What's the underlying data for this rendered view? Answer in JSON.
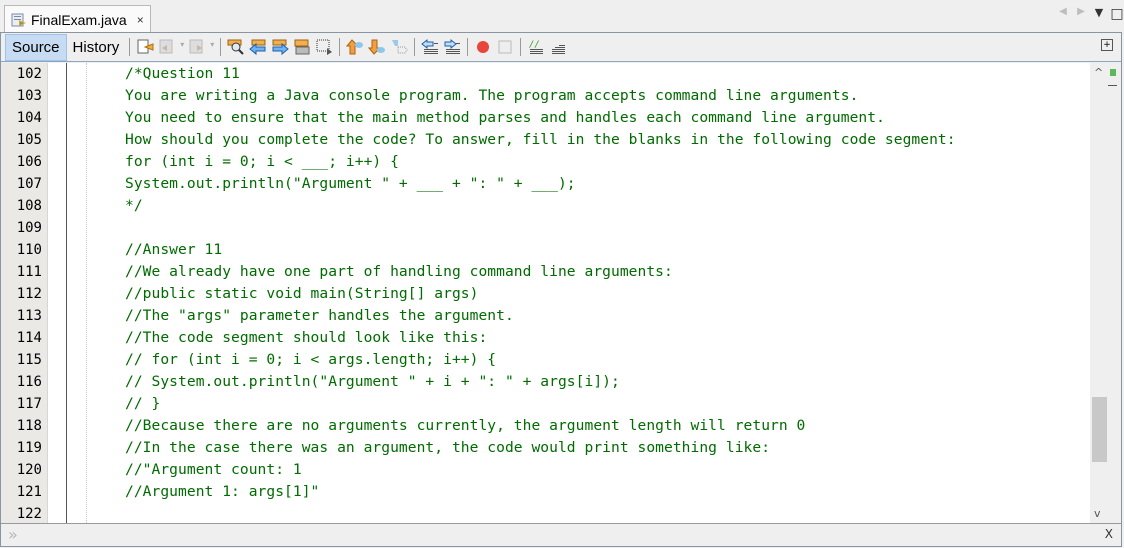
{
  "tab": {
    "title": "FinalExam.java",
    "close": "×"
  },
  "window_controls": {
    "left": "◀",
    "right": "▶",
    "menu": "▼",
    "maximize": "□"
  },
  "toolbar": {
    "source_label": "Source",
    "history_label": "History",
    "icons": [
      "last-edit-icon",
      "back-icon",
      "forward-icon",
      "find-icon",
      "find-previous-icon",
      "find-next-icon",
      "toggle-highlight-icon",
      "toggle-rect-select-icon",
      "previous-bookmark-icon",
      "next-bookmark-icon",
      "toggle-bookmark-icon",
      "shift-left-icon",
      "shift-right-icon",
      "start-macro-icon",
      "stop-macro-icon",
      "comment-icon",
      "uncomment-icon"
    ],
    "expand": "+"
  },
  "editor": {
    "line_numbers": [
      "102",
      "103",
      "104",
      "105",
      "106",
      "107",
      "108",
      "109",
      "110",
      "111",
      "112",
      "113",
      "114",
      "115",
      "116",
      "117",
      "118",
      "119",
      "120",
      "121",
      "122"
    ],
    "lines": [
      "/*Question 11",
      "You are writing a Java console program. The program accepts command line arguments.",
      "You need to ensure that the main method parses and handles each command line argument.",
      "How should you complete the code? To answer, fill in the blanks in the following code segment:",
      "for (int i = 0; i < ___; i++) {",
      "System.out.println(\"Argument \" + ___ + \": \" + ___);",
      "*/",
      "",
      "//Answer 11",
      "//We already have one part of handling command line arguments:",
      "//public static void main(String[] args)",
      "//The \"args\" parameter handles the argument.",
      "//The code segment should look like this:",
      "// for (int i = 0; i < args.length; i++) {",
      "// System.out.println(\"Argument \" + i + \": \" + args[i]);",
      "// }",
      "//Because there are no arguments currently, the argument length will return 0",
      "//In the case there was an argument, the code would print something like:",
      "//\"Argument count: 1",
      "//Argument 1: args[1]\"",
      ""
    ],
    "text_color": "#006b00"
  },
  "scrollbar": {
    "up": "^",
    "down": "v"
  },
  "bottom": {
    "chevron": "»",
    "close": "X"
  }
}
